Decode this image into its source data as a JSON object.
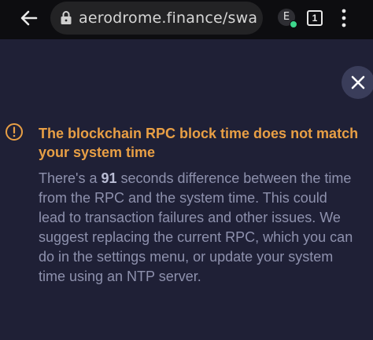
{
  "browser": {
    "url": "aerodrome.finance/swap...",
    "extension_badge": "E",
    "tab_count": "1"
  },
  "alert": {
    "title": "The blockchain RPC block time does not match your system time",
    "body_prefix": "There's a ",
    "seconds": "91",
    "body_suffix": " seconds difference between the time from the RPC and the system time. This could lead to transaction failures and other issues. We suggest replacing the current RPC, which you can do in the settings menu, or update your system time using an NTP server."
  },
  "colors": {
    "background": "#1f2036",
    "warning": "#e89f45",
    "body_text": "#8e91ad"
  },
  "icons": {
    "back": "arrow-left-icon",
    "lock": "lock-icon",
    "menu": "more-vertical-icon",
    "close": "close-icon",
    "alert": "alert-circle-icon"
  }
}
